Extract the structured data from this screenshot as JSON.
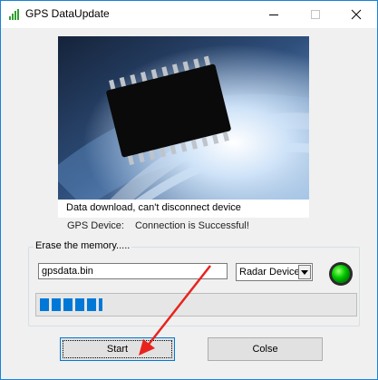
{
  "window": {
    "title": "GPS DataUpdate",
    "icon": "signal-bars-icon",
    "controls": [
      "minimize-icon",
      "maximize-icon",
      "close-icon"
    ]
  },
  "banner": {
    "image": "chip-banner-image"
  },
  "message": "Data download, can't disconnect device",
  "status": {
    "label": "GPS Device:",
    "value": "Connection is Successful!"
  },
  "erase_group": {
    "legend": "Erase the memory.....",
    "file_value": "gpsdata.bin",
    "device_selected": "Radar Device:",
    "led_color": "#00cc00"
  },
  "progress": {
    "fraction": 0.2
  },
  "buttons": {
    "start": "Start",
    "close": "Colse"
  },
  "annotation": {
    "arrow_color": "#e8231e"
  }
}
